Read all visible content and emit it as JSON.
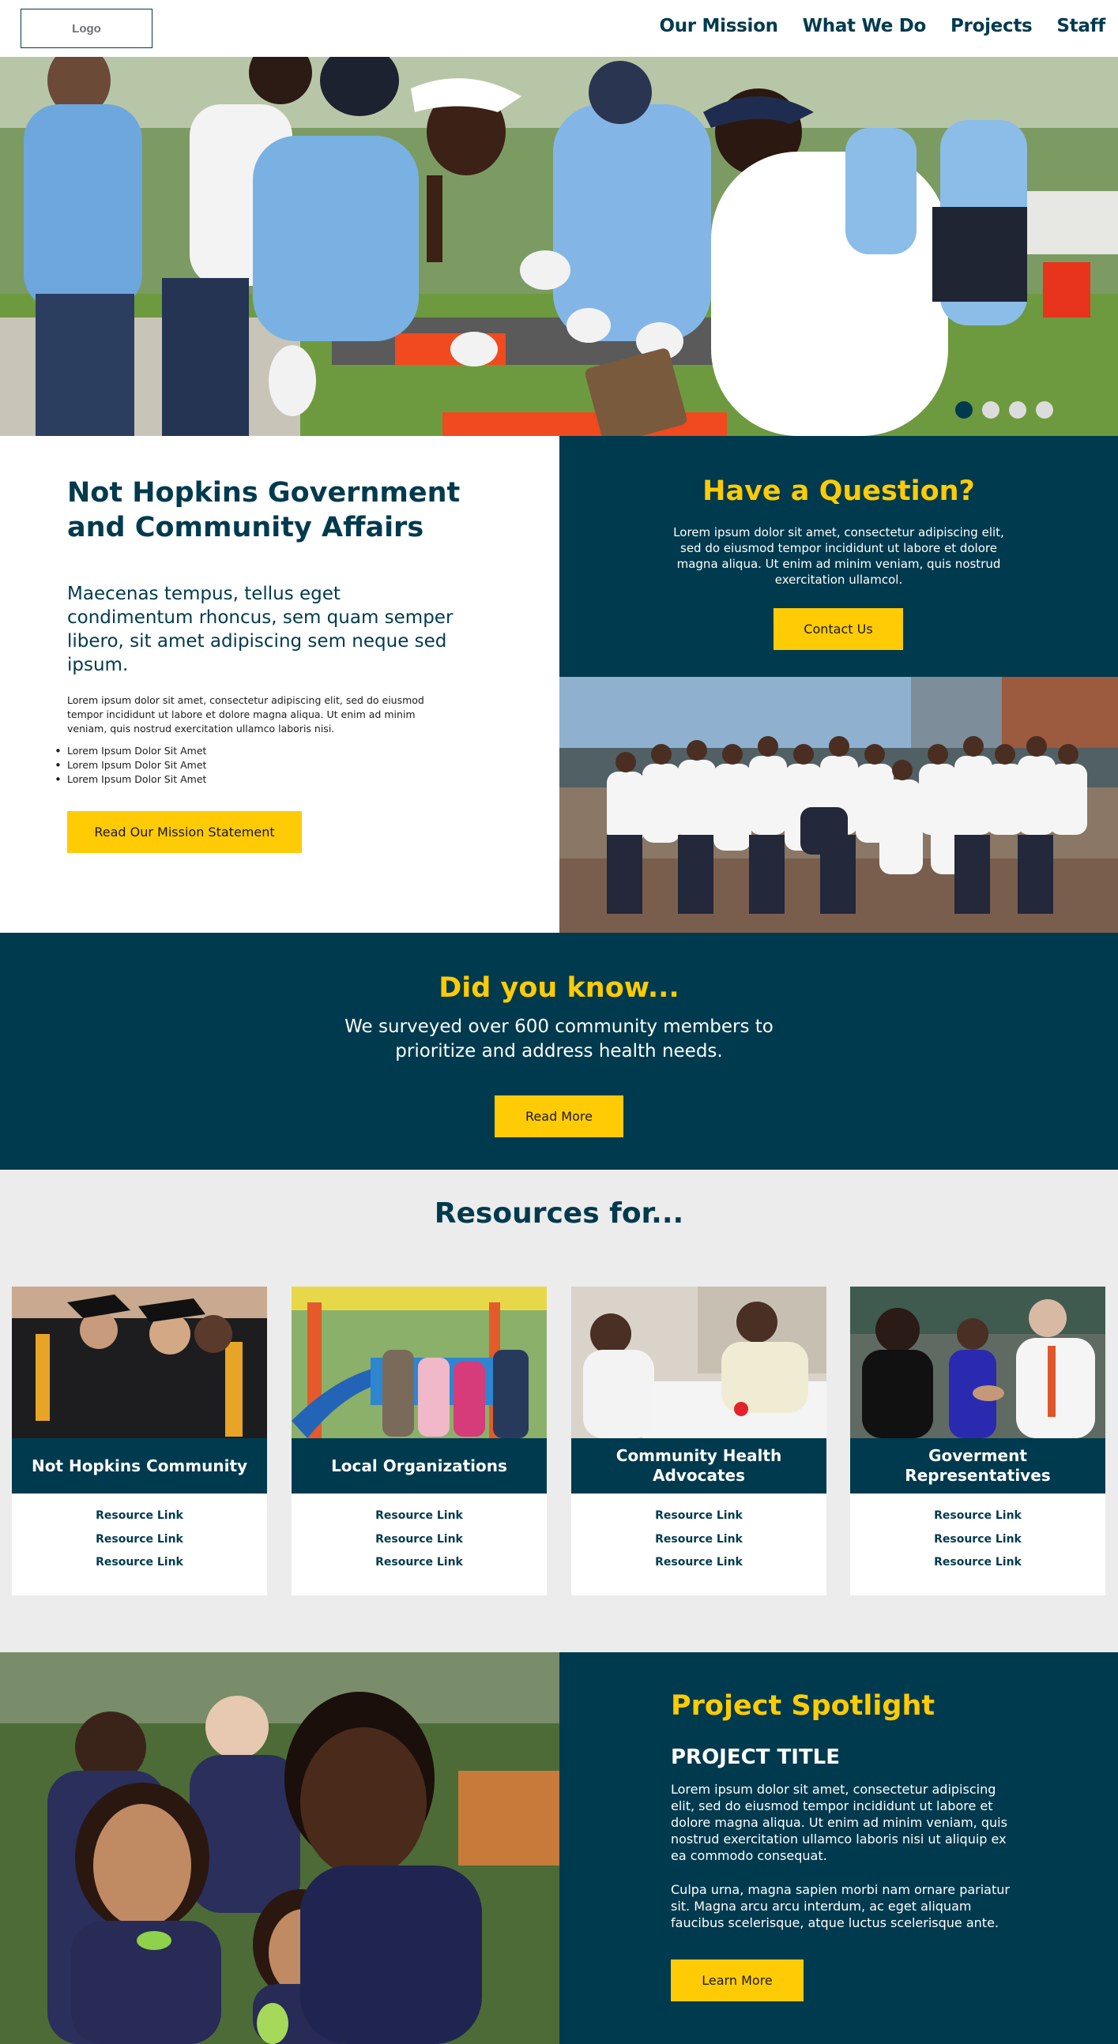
{
  "header": {
    "logo_label": "Logo",
    "nav": [
      "Our Mission",
      "What We Do",
      "Projects",
      "Staff"
    ]
  },
  "hero": {
    "slides_total": 4,
    "active_slide": 1
  },
  "intro": {
    "title": "Not Hopkins Government and Community Affairs",
    "lead": "Maecenas tempus, tellus eget condimentum rhoncus, sem quam semper libero, sit amet adipiscing sem neque sed ipsum.",
    "body": "Lorem ipsum dolor sit amet, consectetur adipiscing elit, sed do eiusmod tempor incididunt ut labore et dolore magna aliqua. Ut enim ad minim veniam, quis nostrud exercitation ullamco laboris nisi.",
    "list": [
      "Lorem Ipsum Dolor Sit Amet",
      "Lorem Ipsum Dolor Sit Amet",
      "Lorem Ipsum Dolor Sit Amet"
    ],
    "button": "Read Our Mission Statement"
  },
  "question": {
    "title": "Have a Question?",
    "body": "Lorem ipsum dolor sit amet, consectetur adipiscing elit, sed do eiusmod tempor incididunt ut labore et dolore magna aliqua. Ut enim ad minim veniam, quis nostrud exercitation ullamcol.",
    "button": "Contact Us"
  },
  "did_you_know": {
    "title": "Did you know...",
    "body": "We surveyed over 600 community members to prioritize and address health needs.",
    "button": "Read More"
  },
  "resources": {
    "title": "Resources for...",
    "cards": [
      {
        "title": "Not Hopkins Community",
        "links": [
          "Resource Link",
          "Resource Link",
          "Resource Link"
        ]
      },
      {
        "title": "Local Organizations",
        "links": [
          "Resource Link",
          "Resource Link",
          "Resource Link"
        ]
      },
      {
        "title": "Community Health Advocates",
        "links": [
          "Resource Link",
          "Resource Link",
          "Resource Link"
        ]
      },
      {
        "title": "Goverment Representatives",
        "links": [
          "Resource Link",
          "Resource Link",
          "Resource Link"
        ]
      }
    ]
  },
  "spotlight": {
    "title": "Project Spotlight",
    "project_title": "PROJECT TITLE",
    "body1": "Lorem ipsum dolor sit amet, consectetur adipiscing elit, sed do eiusmod tempor incididunt ut labore et dolore magna aliqua. Ut enim ad minim veniam, quis nostrud exercitation ullamco laboris nisi ut aliquip ex ea commodo consequat.",
    "body2": "Culpa urna, magna sapien morbi nam ornare pariatur sit. Magna arcu arcu interdum, ac eget aliquam faucibus scelerisque, atque luctus scelerisque ante.",
    "button": "Learn More"
  },
  "colors": {
    "navy": "#003a4e",
    "gold": "#ffcb05",
    "light_gray": "#ececec"
  }
}
